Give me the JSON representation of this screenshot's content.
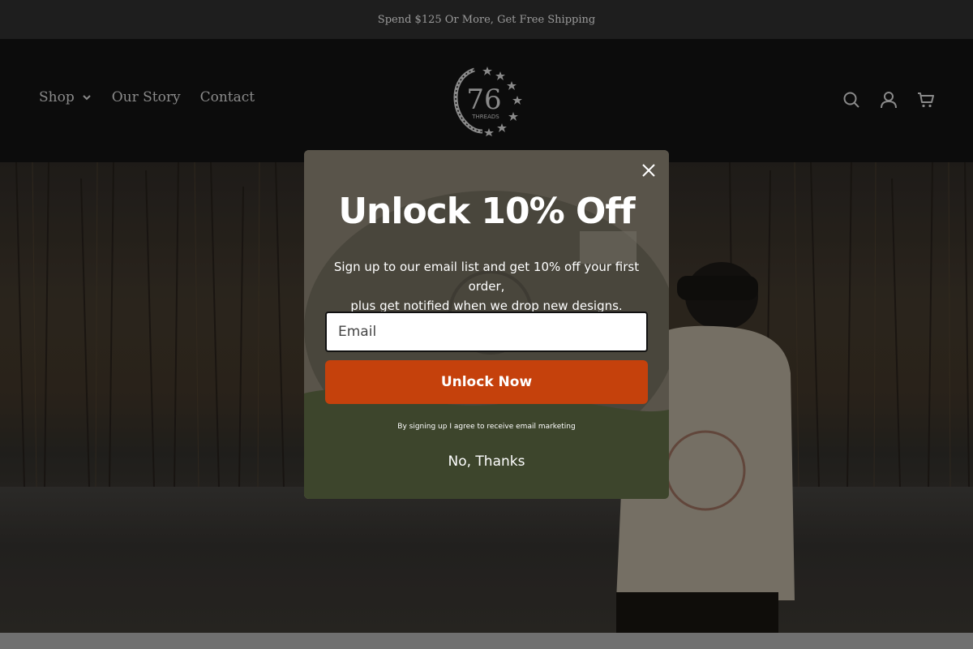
{
  "announcement": {
    "text": "Spend $125 Or More, Get Free Shipping"
  },
  "header": {
    "nav": [
      {
        "label": "Shop",
        "has_dropdown": true
      },
      {
        "label": "Our Story"
      },
      {
        "label": "Contact"
      }
    ],
    "logo": {
      "text": "76",
      "subtext": "THREADS"
    },
    "icons": [
      "search-icon",
      "account-icon",
      "cart-icon"
    ]
  },
  "popup": {
    "headline": "Unlock 10% Off",
    "subtext_line1": "Sign up to our email list and get 10% off your first order,",
    "subtext_line2": "plus get notified when we drop new designs.",
    "email_placeholder": "Email",
    "button_label": "Unlock Now",
    "legal": "By signing up I agree to receive email marketing",
    "dismiss_label": "No, Thanks",
    "accent_color": "#c5410c"
  },
  "colors": {
    "announcement_bg": "#1e1e1e",
    "header_bg": "#0c0c0c"
  }
}
